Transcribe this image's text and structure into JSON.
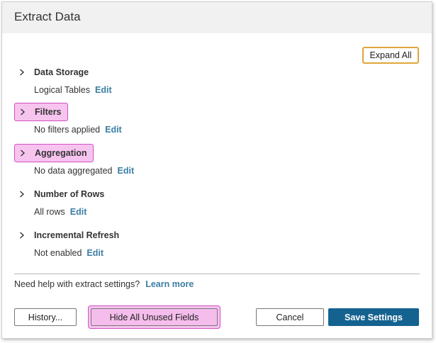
{
  "dialog": {
    "title": "Extract Data"
  },
  "expand_all_label": "Expand All",
  "sections": [
    {
      "title": "Data Storage",
      "subtitle": "Logical Tables",
      "edit": "Edit",
      "highlighted": false
    },
    {
      "title": "Filters",
      "subtitle": "No filters applied",
      "edit": "Edit",
      "highlighted": true
    },
    {
      "title": "Aggregation",
      "subtitle": "No data aggregated",
      "edit": "Edit",
      "highlighted": true
    },
    {
      "title": "Number of Rows",
      "subtitle": "All rows",
      "edit": "Edit",
      "highlighted": false
    },
    {
      "title": "Incremental Refresh",
      "subtitle": "Not enabled",
      "edit": "Edit",
      "highlighted": false
    }
  ],
  "help": {
    "text": "Need help with extract settings?",
    "link": "Learn more"
  },
  "buttons": {
    "history": "History...",
    "hide_unused": "Hide All Unused Fields",
    "cancel": "Cancel",
    "save": "Save Settings"
  },
  "colors": {
    "highlight_fill": "#f7c4ef",
    "highlight_border": "#d24fc4",
    "expand_border": "#e0a53b",
    "link": "#3b7ea3",
    "primary": "#14628f"
  },
  "icons": {
    "section_toggle": "chevron-right-icon"
  }
}
